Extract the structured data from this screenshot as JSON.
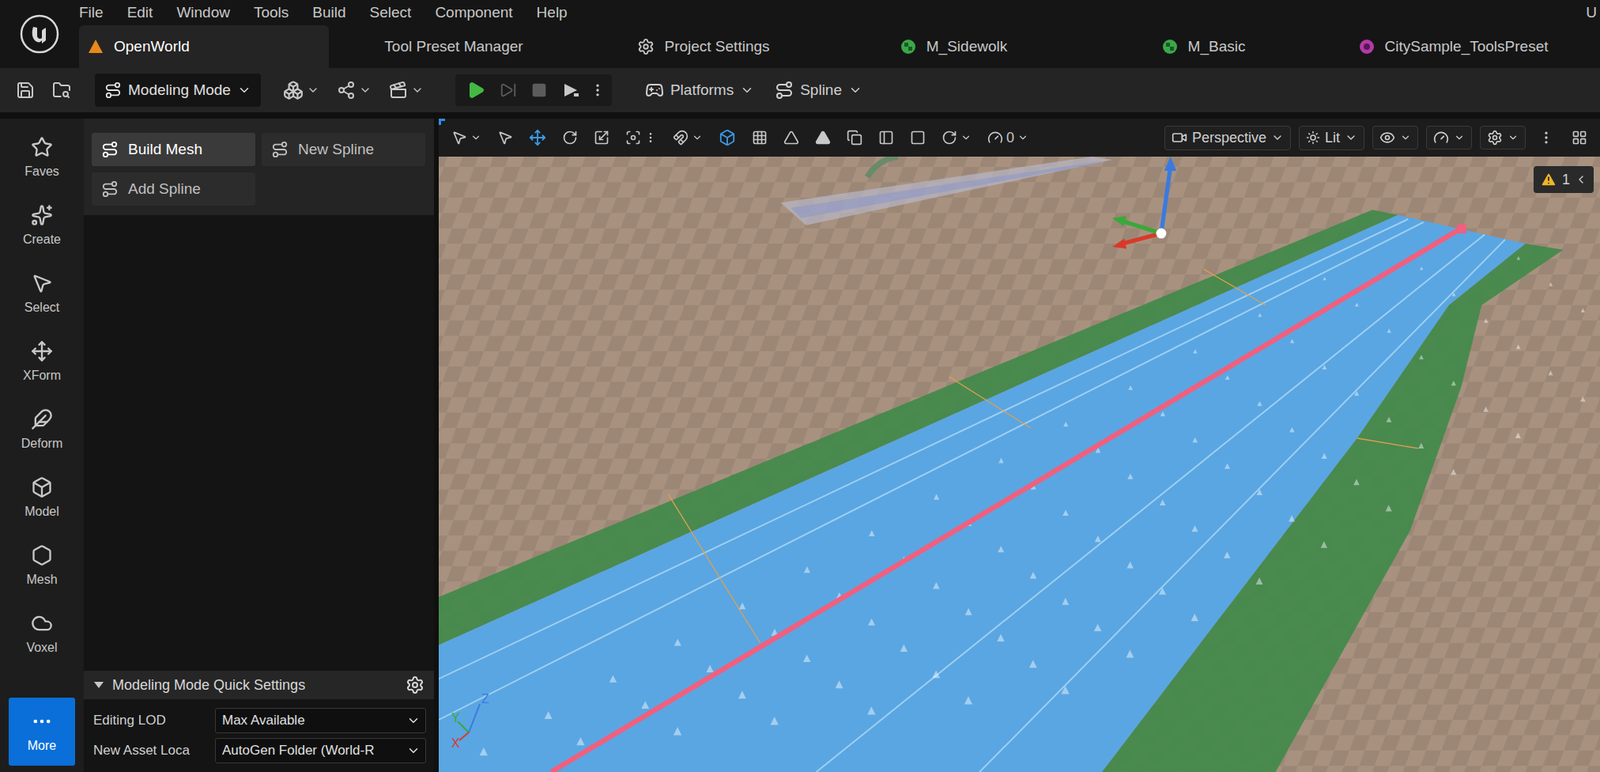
{
  "menu": [
    "File",
    "Edit",
    "Window",
    "Tools",
    "Build",
    "Select",
    "Component",
    "Help"
  ],
  "header_right": "U",
  "tabs": [
    {
      "label": "OpenWorld",
      "selected": true,
      "kind": "level",
      "color": "#e8891a"
    },
    {
      "label": "Tool Preset Manager",
      "selected": false,
      "kind": "blank",
      "color": "#2a2a2a"
    },
    {
      "label": "Project Settings",
      "selected": false,
      "kind": "settings",
      "color": "#c8c8c8"
    },
    {
      "label": "M_Sidewolk",
      "selected": false,
      "kind": "material",
      "color": "#3aa84a"
    },
    {
      "label": "M_Basic",
      "selected": false,
      "kind": "material",
      "color": "#3aa84a"
    },
    {
      "label": "CitySample_ToolsPreset",
      "selected": false,
      "kind": "preset",
      "color": "#b23aa6"
    }
  ],
  "toolbar": {
    "mode": "Modeling Mode",
    "platforms": "Platforms",
    "spline": "Spline",
    "play_controls": [
      {
        "kind": "play",
        "disabled": false
      },
      {
        "kind": "advance",
        "disabled": true
      },
      {
        "kind": "stop",
        "disabled": true
      },
      {
        "kind": "eject",
        "disabled": false
      }
    ]
  },
  "rail": [
    {
      "label": "Faves",
      "selected": false
    },
    {
      "label": "Create",
      "selected": false
    },
    {
      "label": "Select",
      "selected": false
    },
    {
      "label": "XForm",
      "selected": false
    },
    {
      "label": "Deform",
      "selected": false
    },
    {
      "label": "Model",
      "selected": false
    },
    {
      "label": "Mesh",
      "selected": false
    },
    {
      "label": "Voxel",
      "selected": false
    },
    {
      "label": "More",
      "selected": true
    }
  ],
  "panel": {
    "buttons": [
      {
        "label": "Build Mesh",
        "hovered": true
      },
      {
        "label": "New Spline",
        "hovered": false
      },
      {
        "label": "Add Spline",
        "hovered": false
      }
    ],
    "quick_settings": {
      "title": "Modeling Mode Quick Settings",
      "expanded": true,
      "fields": [
        {
          "label": "Editing LOD",
          "value": "Max Available"
        },
        {
          "label": "New Asset Loca",
          "value": "AutoGen Folder (World-R"
        }
      ]
    }
  },
  "viewport": {
    "view": "Perspective",
    "lighting": "Lit",
    "snap_angle": "0",
    "warnings": "1",
    "axes": [
      "Z",
      "Y",
      "X"
    ]
  }
}
